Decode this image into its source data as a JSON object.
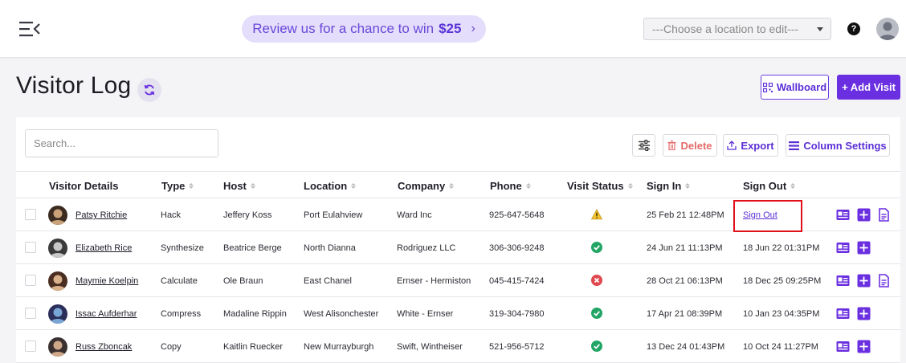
{
  "header": {
    "promo_text": "Review us for a chance to win",
    "promo_amount": "$25",
    "location_placeholder": "---Choose a location to edit---",
    "help_label": "?"
  },
  "page": {
    "title": "Visitor Log",
    "wallboard_label": "Wallboard",
    "add_visit_label": "+ Add Visit"
  },
  "toolbar": {
    "search_placeholder": "Search...",
    "delete_label": "Delete",
    "export_label": "Export",
    "column_settings_label": "Column Settings"
  },
  "table": {
    "columns": [
      "Visitor Details",
      "Type",
      "Host",
      "Location",
      "Company",
      "Phone",
      "Visit Status",
      "Sign In",
      "Sign Out"
    ],
    "rows": [
      {
        "name": "Patsy Ritchie",
        "type": "Hack",
        "host": "Jeffery Koss",
        "location": "Port Eulahview",
        "company": "Ward Inc",
        "phone": "925-647-5648",
        "status": "warning",
        "sign_in": "25 Feb 21 12:48PM",
        "sign_out": "Sign Out"
      },
      {
        "name": "Elizabeth Rice",
        "type": "Synthesize",
        "host": "Beatrice Berge",
        "location": "North Dianna",
        "company": "Rodriguez LLC",
        "phone": "306-306-9248",
        "status": "approved",
        "sign_in": "24 Jun 21 11:13PM",
        "sign_out": "18 Jun 22 01:31PM"
      },
      {
        "name": "Maymie Koelpin",
        "type": "Calculate",
        "host": "Ole Braun",
        "location": "East Chanel",
        "company": "Ernser - Hermiston",
        "phone": "045-415-7424",
        "status": "rejected",
        "sign_in": "28 Oct 21 06:13PM",
        "sign_out": "18 Dec 25 09:25PM"
      },
      {
        "name": "Issac Aufderhar",
        "type": "Compress",
        "host": "Madaline Rippin",
        "location": "West Alisonchester",
        "company": "White - Ernser",
        "phone": "319-304-7980",
        "status": "approved",
        "sign_in": "17 Apr 21 08:39PM",
        "sign_out": "10 Jan 23 04:35PM"
      },
      {
        "name": "Russ Zboncak",
        "type": "Copy",
        "host": "Kaitlin Ruecker",
        "location": "New Murrayburgh",
        "company": "Swift, Wintheiser",
        "phone": "521-956-5712",
        "status": "approved",
        "sign_in": "13 Dec 24 01:43PM",
        "sign_out": "10 Oct 24 11:27PM"
      }
    ]
  },
  "colors": {
    "accent": "#6a2fe0",
    "approved": "#22a565",
    "rejected": "#e0484f",
    "warning": "#f2c12e",
    "highlight": "#e0101a"
  }
}
